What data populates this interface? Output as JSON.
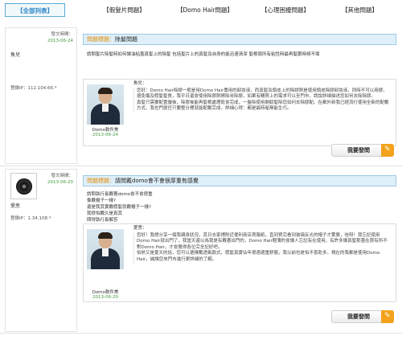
{
  "tabs": [
    {
      "label": "【全部列表】",
      "active": true
    },
    {
      "label": "【假髮片問題】",
      "active": false
    },
    {
      "label": "【Domo Hair問題】",
      "active": false
    },
    {
      "label": "【心理困擾問題】",
      "active": false
    },
    {
      "label": "【其他問題】",
      "active": false
    }
  ],
  "posts": [
    {
      "posted_label": "發文時間：",
      "posted_date": "2013-06-24",
      "username": "魚兒",
      "ip_label": "登錄IP：",
      "ip": "112.104.66.*",
      "question_label": "問題標題：",
      "question_title": "除髮問題",
      "question_body": [
        "請問髮片除髮時如何讓油粘蓋真髮上的除髮 包括髮片上的真髮及自身的能迅速清潔 髮根周所有粘性時最再髮跟時候不壞"
      ],
      "reply": {
        "author": "Domo軟件美",
        "date": "2013-06-24",
        "greeting": "魚兒：",
        "body": [
          "您好：Domo Hair除膠一般是用Domo Hair專用的卸妝液，而真髮及頭皮上的除膠劑是使用頭皮除膠卸妝液，同時不可以用膠，避免傷及假髮髮質，我平日還會使用除膠劑擦除米除膠，如果有購買上的需求可以至門市，請說詳細描述您如何去除除膠。",
          "真髮只需要配置優後，除膠後能再髮根處理乾會完成，一盤除使用剩餘髮除您如何去除膠配。在都外新我已經流行使用全新的配戴方式，我也門提任只要整分裡就能配戴完成，詳細心得：都是最時髦無能生巧。"
        ]
      },
      "ask_button": "我要發問"
    },
    {
      "posted_label": "發文時間：",
      "posted_date": "2013-06-20",
      "username": "愛思",
      "ip_label": "登錄IP：",
      "ip": "1.34.108.*",
      "question_label": "問題標題：",
      "question_title": "請問戴domo會不會很厚重有感覺",
      "question_body": [
        "請問執行長戴著domo會不會很重",
        "像戴帽子一樣?",
        "還是我其實戴假髮就戴帽子一樣?",
        "我很怕戴久是真其",
        "問得執行長解答"
      ],
      "reply": {
        "author": "Domo軟件美",
        "date": "2013-06-20",
        "greeting": "愛思：",
        "body": [
          "您好！我想分享一個我親身狀況，其日去家裡附近便利商店買報紙，直到買完看到玻璃反光的帽子才驚覺，哇呀！我忘記使用Domo Hair就出門了，我當天還以為我是有戴著出門的，Domo Hair輕薄的會讓人忘記有在使用，有許多讓真髮那蓋在那有所不對Domo Hair，才會覺得各位完全記好吧。",
          "怕熱又是夏天的話，您可以選擇戴透氣款式，假髮真實佔年很適適重舒服，我以前也是怕不喜乾多，現在的我都是使用Domo Hair，誠讓您來門市進行更詳細的了解。"
        ]
      },
      "ask_button": "我要發問"
    }
  ]
}
